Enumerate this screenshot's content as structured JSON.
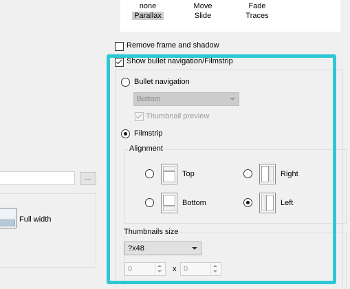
{
  "effects": {
    "items": [
      {
        "label": "none",
        "selected": false
      },
      {
        "label": "Move",
        "selected": false
      },
      {
        "label": "Fade",
        "selected": false
      },
      {
        "label": "Parallax",
        "selected": true
      },
      {
        "label": "Slide",
        "selected": false
      },
      {
        "label": "Traces",
        "selected": false
      }
    ]
  },
  "options": {
    "remove_frame": {
      "label": "Remove frame and shadow",
      "checked": false
    },
    "show_bullets": {
      "label": "Show bullet navigation/Filmstrip",
      "checked": true
    }
  },
  "nav": {
    "bullet": {
      "label": "Bullet navigation",
      "selected": false
    },
    "bullet_position": {
      "value": "Bottom",
      "disabled": true
    },
    "thumbnail_preview": {
      "label": "Thumbnail preview",
      "checked": true,
      "disabled": true
    },
    "filmstrip": {
      "label": "Filmstrip",
      "selected": true
    }
  },
  "alignment": {
    "title": "Alignment",
    "options": [
      {
        "key": "top",
        "label": "Top",
        "selected": false
      },
      {
        "key": "right",
        "label": "Right",
        "selected": false
      },
      {
        "key": "bottom",
        "label": "Bottom",
        "selected": false
      },
      {
        "key": "left",
        "label": "Left",
        "selected": true
      }
    ]
  },
  "thumbnails": {
    "title": "Thumbnails size",
    "size_value": "?x48",
    "width_value": "0",
    "separator": "x",
    "height_value": "0"
  },
  "left_panel": {
    "browse_label": "...",
    "full_width_label": "Full width"
  },
  "colors": {
    "highlight": "#2ec8d2",
    "selected_effect_bg": "#cccccc"
  }
}
